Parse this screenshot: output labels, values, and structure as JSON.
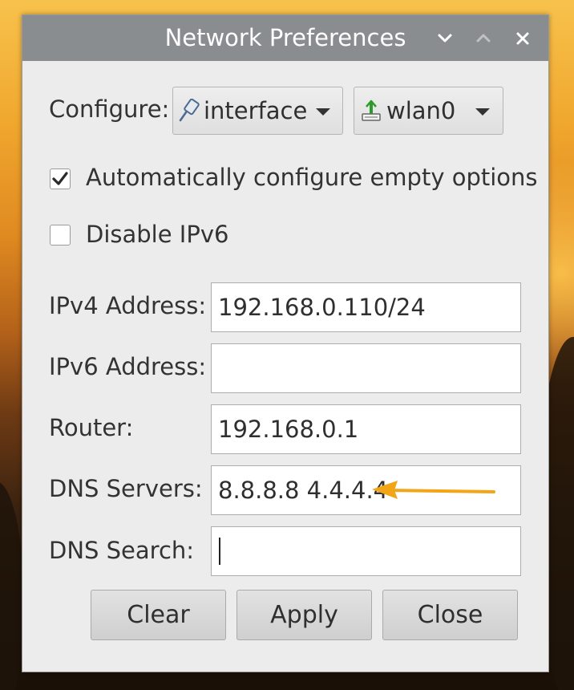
{
  "window": {
    "title": "Network Preferences"
  },
  "configure": {
    "label": "Configure:",
    "type_value": "interface",
    "interface_value": "wlan0"
  },
  "options": {
    "auto_configure_label": "Automatically configure empty options",
    "auto_configure_checked": true,
    "disable_ipv6_label": "Disable IPv6",
    "disable_ipv6_checked": false
  },
  "fields": {
    "ipv4_label": "IPv4 Address:",
    "ipv4_value": "192.168.0.110/24",
    "ipv6_label": "IPv6 Address:",
    "ipv6_value": "",
    "router_label": "Router:",
    "router_value": "192.168.0.1",
    "dns_servers_label": "DNS Servers:",
    "dns_servers_value": "8.8.8.8 4.4.4.4",
    "dns_search_label": "DNS Search:",
    "dns_search_value": ""
  },
  "buttons": {
    "clear_label": "Clear",
    "apply_label": "Apply",
    "close_label": "Close"
  },
  "icons": {
    "type_icon": "network-plug-icon",
    "interface_icon": "wireless-network-icon",
    "annotation": "arrow-left-icon"
  },
  "colors": {
    "annotation_arrow": "#f2a516",
    "titlebar": "#8a8d90",
    "dialog_background": "#ececec"
  }
}
